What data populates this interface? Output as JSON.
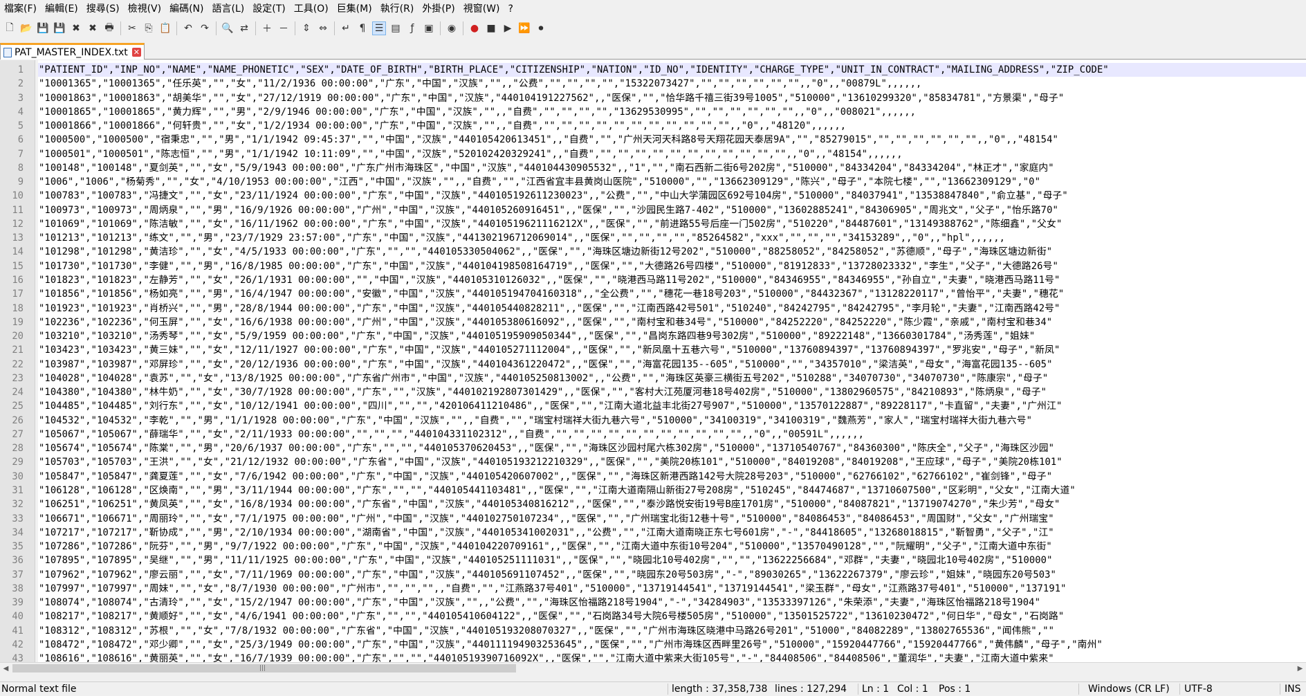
{
  "menu": [
    "檔案(F)",
    "編輯(E)",
    "搜尋(S)",
    "檢視(V)",
    "編碼(N)",
    "語言(L)",
    "設定(T)",
    "工具(O)",
    "巨集(M)",
    "執行(R)",
    "外掛(P)",
    "視窗(W)",
    "?"
  ],
  "toolbar_icons": [
    "new-file-icon",
    "open-file-icon",
    "save-icon",
    "save-all-icon",
    "close-icon",
    "close-all-icon",
    "print-icon",
    "cut-icon",
    "copy-icon",
    "paste-icon",
    "undo-icon",
    "redo-icon",
    "find-icon",
    "replace-icon",
    "zoom-in-icon",
    "zoom-out-icon",
    "sync-v-icon",
    "sync-h-icon",
    "word-wrap-icon",
    "all-chars-icon",
    "indent-guide-icon",
    "doc-map-icon",
    "function-list-icon",
    "folder-workspace-icon",
    "monitor-icon",
    "record-macro-icon",
    "stop-record-icon",
    "play-macro-icon",
    "run-multiple-icon",
    "save-macro-icon"
  ],
  "tab": {
    "filename": "PAT_MASTER_INDEX.txt"
  },
  "lines": [
    "\"PATIENT_ID\",\"INP_NO\",\"NAME\",\"NAME_PHONETIC\",\"SEX\",\"DATE_OF_BIRTH\",\"BIRTH_PLACE\",\"CITIZENSHIP\",\"NATION\",\"ID_NO\",\"IDENTITY\",\"CHARGE_TYPE\",\"UNIT_IN_CONTRACT\",\"MAILING_ADDRESS\",\"ZIP_CODE\"",
    "\"10001365\",\"10001365\",\"任乐英\",\"\",\"女\",\"11/2/1936 00:00:00\",\"广东\",\"中国\",\"汉族\",\"\",,\"公费\",\"\",\"\",\"\",\"\",\"15322073427\",\"\",\"\",\"\",\"\",\"\",\"\",,\"0\",,\"00879L\",,,,,,",
    "\"10001863\",\"10001863\",\"胡美华\",\"\",\"女\",\"27/12/1919 00:00:00\",\"广东\",\"中国\",\"汉族\",\"440104191227562\",,\"医保\",\"\",\"恰华路千禧三街39号1005\",\"510000\",\"13610299320\",\"85834781\",\"方景渠\",\"母子\"",
    "\"10001865\",\"10001865\",\"黄力辉\",\"\",\"男\",\"2/9/1946 00:00:00\",\"广东\",\"中国\",\"汉族\",\"\",,\"自费\",\"\",\"\",\"\",\"\",\"13629530995\",\"\",\"\",\"\",\"\",\"\",\"\",,\"0\",,\"008021\",,,,,,",
    "\"10001866\",\"10001866\",\"何轩贵\",\"\",\"女\",\"1/2/1934 00:00:00\",\"广东\",\"中国\",\"汉族\",\"\",,\"自费\",\"\",\"\",\"\",\"\",\"\",\"\",\"\",\"\",\"\",\"\",\"\",,\"0\",,\"48120\",,,,,,",
    "\"1000500\",\"1000500\",\"宿秉忠\",\"\",\"男\",\"1/1/1942 09:45:37\",\"\",\"中国\",\"汉族\",\"440105420613451\",,\"自费\",\"\",\"广州天河天科路8号天翔花园天泰居9A\",\"\",\"85279015\",\"\",\"\",\"\",\"\",\"\",\"\",,\"0\",,\"48154\"",
    "\"1000501\",\"1000501\",\"陈志恒\",\"\",\"男\",\"1/1/1942 10:11:09\",\"\",\"中国\",\"汉族\",\"520102420329241\",,\"自费\",\"\",\"\",\"\",\"\",\"\",\"\",\"\",\"\",\"\",\"\",\"\",,\"0\",,\"48154\",,,,,,",
    "\"100148\",\"100148\",\"夏剑英\",\"\",\"女\",\"5/9/1943 00:00:00\",\"广东广州市海珠区\",\"中国\",\"汉族\",\"440104430905532\",,\"1\",\"\",\"南石西新二街6号202房\",\"510000\",\"84334204\",\"84334204\",\"林正才\",\"家庭内\"",
    "\"1006\",\"1006\",\"杨菊秀\",\"\",\"女\",\"4/10/1953 00:00:00\",\"江西\",\"中国\",\"汉族\",\"\",,\"自费\",\"\",\"江西省宜丰县黄岗山医院\",\"510000\",\"\",\"13662309129\",\"陈兴\",\"母子\",\"本院七楼\",\"\",\"13662309129\",\"0\"",
    "\"100783\",\"100783\",\"冯捷文\",\"\",\"女\",\"23/11/1924 00:00:00\",\"广东\",\"中国\",\"汉族\",\"440105192611230023\",,\"公费\",\"\",\"中山大学蒲园区692号104房\",\"510000\",\"84037941\",\"13538847840\",\"俞立基\",\"母子\"",
    "\"100973\",\"100973\",\"周炳泉\",\"\",\"男\",\"16/9/1926 00:00:00\",\"广州\",\"中国\",\"汉族\",\"440105260916451\",,\"医保\",\"\",\"沙园民生路7-402\",\"510000\",\"13602885241\",\"84306905\",\"周兆文\",\"父子\",\"怡乐路70\"",
    "\"101069\",\"101069\",\"陈洁敏\",\"\",\"女\",\"16/11/1962 00:00:00\",\"广东\",\"中国\",\"汉族\",\"44010519621116212X\",,\"医保\",\"\",\"前进路55号后座一门502房\",\"510220\",\"84487601\",\"13149388762\",\"陈细鑫\",\"父女\"",
    "\"101213\",\"101213\",\"练文\",\"\",\"男\",\"23/7/1929 23:57:00\",\"广东\",\"中国\",\"汉族\",\"441302196712069014\",,\"医保\",\"\",\"\",\"\",\"\",\"85264582\",\"xxx\",\"\",\"\",\"\",\"34153289\",,\"0\",,\"hpl\",,,,,,",
    "\"101298\",\"101298\",\"黄洁珍\",\"\",\"女\",\"4/5/1933 00:00:00\",\"广东\",\"\",\"\",\"440105330504062\",,\"医保\",\"\",\"海珠区塘边新街12号202\",\"510000\",\"88258052\",\"84258052\",\"苏德顺\",\"母子\",\"海珠区塘边新街\"",
    "\"101730\",\"101730\",\"李健\",\"\",\"男\",\"16/8/1985 00:00:00\",\"广东\",\"中国\",\"汉族\",\"440104198508164719\",,\"医保\",\"\",\"大德路26号四楼\",\"510000\",\"81912833\",\"13728023332\",\"李生\",\"父子\",\"大德路26号\"",
    "\"101823\",\"101823\",\"左静芳\",\"\",\"女\",\"26/1/1931 00:00:00\",\"\",\"中国\",\"汉族\",\"440105310126032\",,\"医保\",\"\",\"晓港西马路11号202\",\"510000\",\"84346955\",\"84346955\",\"孙自立\",\"夫妻\",\"晓港西马路11号\"",
    "\"101856\",\"101856\",\"杨如亮\",\"\",\"男\",\"16/4/1947 00:00:00\",\"安徽\",\"中国\",\"汉族\",\"440105194704160318\",,\"全公费\",\"\",\"穗花一巷18号203\",\"510000\",\"84432367\",\"13128220117\",\"曾怡平\",\"夫妻\",\"穗花\"",
    "\"101923\",\"101923\",\"肖桥兴\",\"\",\"男\",\"28/8/1944 00:00:00\",\"广东\",\"中国\",\"汉族\",\"440105440828211\",,\"医保\",\"\",\"江南西路42号501\",\"510240\",\"84242795\",\"84242795\",\"李月轮\",\"夫妻\",\"江南西路42号\"",
    "\"102236\",\"102236\",\"何玉屏\",\"\",\"女\",\"16/6/1938 00:00:00\",\"广州\",\"中国\",\"汉族\",\"440105380616092\",,\"医保\",\"\",\"南村宝和巷34号\",\"510000\",\"84252220\",\"84252220\",\"陈少霞\",\"亲戚\",\"南村宝和巷34\"",
    "\"103210\",\"103210\",\"汤秀琴\",\"\",\"女\",\"5/9/1959 00:00:00\",\"广东\",\"中国\",\"汉族\",\"440105195909050344\",,\"医保\",\"\",\"昌岗东路四巷9号302房\",\"510000\",\"89222148\",\"13660301784\",\"汤秀莲\",\"姐妹\"",
    "\"103423\",\"103423\",\"黄三妹\",\"\",\"女\",\"12/11/1927 00:00:00\",\"广东\",\"中国\",\"汉族\",\"440105271112004\",,\"医保\",\"\",\"新凤凰十五巷六号\",\"510000\",\"13760894397\",\"13760894397\",\"罗兆安\",\"母子\",\"新凤\"",
    "\"103987\",\"103987\",\"邓屏珍\",\"\",\"女\",\"20/12/1936 00:00:00\",\"广东\",\"中国\",\"汉族\",\"440104361220472\",,\"医保\",\"\",\"海富花园135--605\",\"510000\",\"\",\"34357010\",\"梁洁英\",\"母女\",\"海富花园135--605\"",
    "\"104028\",\"104028\",\"袁苏\",\"\",\"女\",\"13/8/1925 00:00:00\",\"广东省广州市\",\"中国\",\"汉族\",\"440105250813002\",,\"公费\",\"\",\"海珠区英豪三横街五号202\",\"510288\",\"34070730\",\"34070730\",\"陈康宗\",\"母子\"",
    "\"104380\",\"104380\",\"林牛奶\",\"\",\"女\",\"30/7/1928 00:00:00\",\"广东\",\"\",\"汉族\",\"440102192807301429\",,\"医保\",\"\",\"客村大江苑厦河巷18号402房\",\"510000\",\"13802960575\",\"84210893\",\"陈炳泉\",\"母子\"",
    "\"104485\",\"104485\",\"刘行东\",\"\",\"女\",\"10/12/1941 00:00:00\",\"四川\",\"\",\"\",\"420106411210486\",,\"医保\",\"\",\"江南大道北益丰北街27号907\",\"510000\",\"13570122887\",\"89228117\",\"卡直留\",\"夫妻\",\"广州江\"",
    "\"104532\",\"104532\",\"李乾\",\"\",\"男\",\"1/1/1928 00:00:00\",\"广东\",\"中国\",\"汉族\",\"\",,\"自费\",\"\",\"瑞宝村瑞祥大街九巷六号\",\"510000\",\"34100319\",\"34100319\",\"魏燕芳\",\"家人\",\"瑞宝村瑞祥大街九巷六号\"",
    "\"105067\",\"105067\",\"薛瑞华\",\"\",\"女\",\"2/11/1933 00:00:00\",\"\",\"\",\"\",\"440104331102312\",,\"自费\",\"\",\"\",\"\",\"\",\"\",\"\",\"\",\"\",\"\",\"\",\"\",,\"0\",,\"00591L\",,,,,,",
    "\"105674\",\"105674\",\"陈棠\",\"\",\"男\",\"20/6/1937 00:00:00\",\"广东\",\"\",\"\",\"440105370620453\",,\"医保\",\"\",\"海珠区沙园村尾六栋302房\",\"510000\",\"13710540767\",\"84360300\",\"陈庆全\",\"父子\",\"海珠区沙园\"",
    "\"105703\",\"105703\",\"王洪\",\"\",\"女\",\"21/12/1932 00:00:00\",\"广东省\",\"中国\",\"汉族\",\"440105193212210329\",,\"医保\",\"\",\"美院20栋101\",\"510000\",\"84019208\",\"84019208\",\"王应球\",\"母子\",\"美院20栋101\"",
    "\"105847\",\"105847\",\"龚夏莲\",\"\",\"女\",\"7/6/1942 00:00:00\",\"广东\",\"中国\",\"汉族\",\"440105420607002\",,\"医保\",\"\",\"海珠区新港西路142号大院28号203\",\"510000\",\"62766102\",\"62766102\",\"崔剑锋\",\"母子\"",
    "\"106128\",\"106128\",\"区焕南\",\"\",\"男\",\"3/11/1944 00:00:00\",\"广东\",\"\",\"\",\"440105441103481\",,\"医保\",\"\",\"江南大道南隔山新街27号208房\",\"510245\",\"84474687\",\"13710607500\",\"区彩明\",\"父女\",\"江南大道\"",
    "\"106251\",\"106251\",\"黄凤英\",\"\",\"女\",\"16/8/1934 00:00:00\",\"广东省\",\"中国\",\"汉族\",\"440105340816212\",,\"医保\",\"\",\"泰沙路悦安街19号B座1701房\",\"510000\",\"84087821\",\"13719074270\",\"朱少芳\",\"母女\"",
    "\"106671\",\"106671\",\"周丽玲\",\"\",\"女\",\"7/1/1975 00:00:00\",\"广州\",\"中国\",\"汉族\",\"440102750107234\",,\"医保\",\"\",\"广州瑞宝北街12巷十号\",\"510000\",\"84086453\",\"84086453\",\"周国财\",\"父女\",\"广州瑞宝\"",
    "\"107217\",\"107217\",\"靳协成\",\"\",\"男\",\"2/10/1934 00:00:00\",\"湖南省\",\"中国\",\"汉族\",\"440105341002031\",,\"公费\",\"\",\"江南大道南晓正东七号601房\",\"-\",\"84418605\",\"13268018815\",\"靳智勇\",\"父子\",\"江\"",
    "\"107286\",\"107286\",\"阮芬\",\"\",\"男\",\"9/7/1922 00:00:00\",\"广东\",\"中国\",\"汉族\",\"440104220709161\",,\"医保\",\"\",\"江南大道中东街10号204\",\"510000\",\"13570490128\",\"\",\"阮耀明\",\"父子\",\"江南大道中东街\"",
    "\"107895\",\"107895\",\"吴继\",\"\",\"男\",\"11/11/1925 00:00:00\",\"广东\",\"中国\",\"汉族\",\"440105251111031\",,\"医保\",\"\",\"晓园北10号402房\",\"\",\"\",\"13622256684\",\"邓群\",\"夫妻\",\"晓园北10号402房\",\"510000\"",
    "\"107962\",\"107962\",\"廖云丽\",\"\",\"女\",\"7/11/1969 00:00:00\",\"广东\",\"中国\",\"汉族\",\"440105691107452\",,\"医保\",\"\",\"晓园东20号503房\",\"-\",\"89030265\",\"13622267379\",\"廖云珍\",\"姐妹\",\"晓园东20号503\"",
    "\"107997\",\"107997\",\"周妹\",\"\",\"女\",\"8/7/1930 00:00:00\",\"广州市\",\"\",\"\",\"\",,\"自费\",\"\",\"江燕路37号401\",\"510000\",\"13719144541\",\"13719144541\",\"梁玉群\",\"母女\",\"江燕路37号401\",\"510000\",\"137191\"",
    "\"108074\",\"108074\",\"古清玲\",\"\",\"女\",\"15/2/1947 00:00:00\",\"广东\",\"中国\",\"汉族\",\"\",,\"公费\",\"\",\"海珠区怡福路218号1904\",\"-\",\"34284903\",\"13533397126\",\"朱荣添\",\"夫妻\",\"海珠区怡福路218号1904\"",
    "\"108217\",\"108217\",\"黄顺好\",\"\",\"女\",\"4/6/1941 00:00:00\",\"广东\",\"\",\"\",\"440105410604122\",,\"医保\",\"\",\"石岗路34号大院6号楼505房\",\"510000\",\"13501525722\",\"13610230472\",\"何日华\",\"母女\",\"石岗路\"",
    "\"108312\",\"108312\",\"苏根\",\"\",\"女\",\"7/8/1932 00:00:00\",\"广东省\",\"中国\",\"汉族\",\"440105193208070327\",,\"医保\",\"\",\"广州市海珠区晓港中马路26号201\",\"51000\",\"84082289\",\"13802765536\",\"闻伟熊\",\"\"",
    "\"108472\",\"108472\",\"邓少卿\",\"\",\"女\",\"25/3/1949 00:00:00\",\"广东\",\"中国\",\"汉族\",\"440111194903253645\",,\"医保\",\"\",\"广州市海珠区西畔里26号\",\"510000\",\"15920447766\",\"15920447766\",\"黄伟麟\",\"母子\",\"南州\"",
    "\"108616\",\"108616\",\"黄丽英\",\"\",\"女\",\"16/7/1939 00:00:00\",\"广东\",\"\",\"\",\"44010519390716092X\",,\"医保\",\"\",\"江南大道中紫来大街105号\",\"-\",\"84408506\",\"84408506\",\"董润华\",\"夫妻\",\"江南大道中紫来\""
  ],
  "status": {
    "filetype": "Normal text file",
    "length": "length : 37,358,738",
    "lines": "lines : 127,294",
    "ln": "Ln : 1",
    "col": "Col : 1",
    "pos": "Pos : 1",
    "eol": "Windows (CR LF)",
    "encoding": "UTF-8",
    "mode": "INS"
  }
}
